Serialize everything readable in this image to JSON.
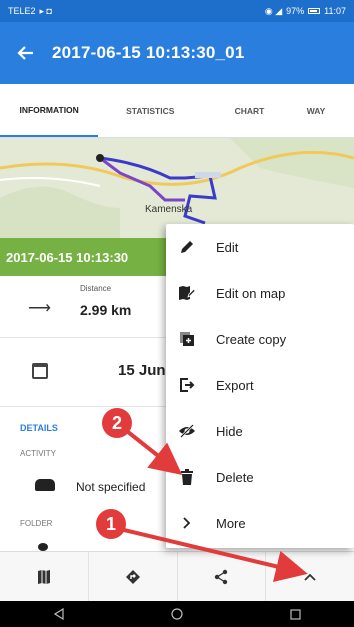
{
  "status_bar": {
    "carrier": "TELE2",
    "right_text": "97%",
    "time": "11:07"
  },
  "app_bar": {
    "back_icon": "arrow-left-icon",
    "title": "2017-06-15 10:13:30_01"
  },
  "tabs": [
    {
      "label": "INFORMATION",
      "active": true
    },
    {
      "label": "STATISTICS",
      "active": false
    },
    {
      "label": "CHART",
      "active": false
    },
    {
      "label": "WAY",
      "active": false
    }
  ],
  "map": {
    "town_label": "Kamenska"
  },
  "track_title": "2017-06-15 10:13:30",
  "stats": {
    "label": "Distance",
    "value": "2.99 km"
  },
  "date": "15 Jun",
  "details": {
    "heading": "DETAILS",
    "activity_label": "ACTIVITY",
    "activity_value": "Not specified",
    "folder_label": "FOLDER"
  },
  "menu": {
    "items": [
      {
        "label": "Edit",
        "icon": "pencil-icon"
      },
      {
        "label": "Edit on map",
        "icon": "edit-map-icon"
      },
      {
        "label": "Create copy",
        "icon": "copy-icon"
      },
      {
        "label": "Export",
        "icon": "export-icon"
      },
      {
        "label": "Hide",
        "icon": "hide-icon"
      },
      {
        "label": "Delete",
        "icon": "trash-icon"
      },
      {
        "label": "More",
        "icon": "chevron-right-icon"
      }
    ]
  },
  "toolbar": {
    "buttons": [
      "map-icon",
      "navigate-icon",
      "share-icon",
      "chevron-up-icon"
    ]
  },
  "annotations": {
    "badge_1": "1",
    "badge_2": "2",
    "accent_color": "#e23b3b"
  },
  "colors": {
    "primary": "#2a7fde",
    "status_bar": "#1d6fcb",
    "track_bar": "#76b243"
  }
}
